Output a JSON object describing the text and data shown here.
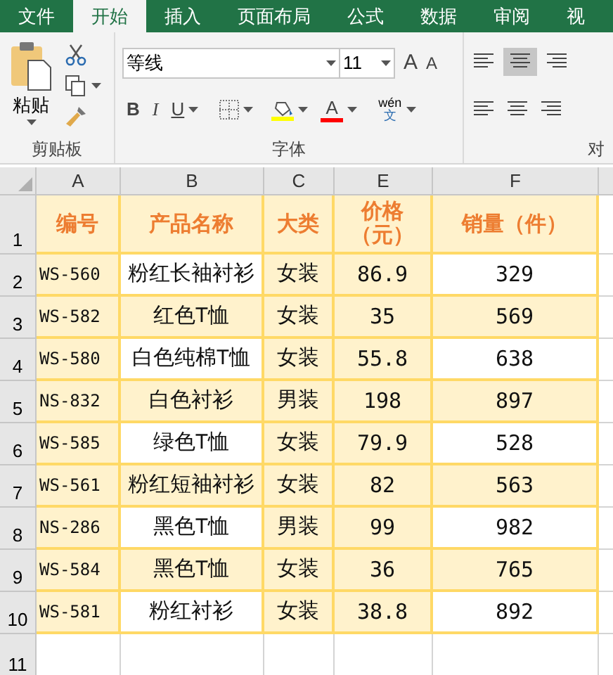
{
  "tabs": [
    {
      "label": "文件",
      "selected": false
    },
    {
      "label": "开始",
      "selected": true
    },
    {
      "label": "插入",
      "selected": false
    },
    {
      "label": "页面布局",
      "selected": false
    },
    {
      "label": "公式",
      "selected": false
    },
    {
      "label": "数据",
      "selected": false
    },
    {
      "label": "审阅",
      "selected": false
    },
    {
      "label": "视",
      "selected": false
    }
  ],
  "clipboard": {
    "paste_label": "粘贴",
    "group_label": "剪贴板"
  },
  "font": {
    "font_name": "等线",
    "font_size": "11",
    "grow": "A",
    "shrink": "A",
    "bold": "B",
    "italic": "I",
    "underline": "U",
    "font_color": "A",
    "phonetic_top": "wén",
    "phonetic_bottom": "文",
    "group_label": "字体"
  },
  "alignment": {
    "group_label": "对"
  },
  "columns": [
    "A",
    "B",
    "C",
    "E",
    "F"
  ],
  "header": {
    "row": "1",
    "cells": [
      "编号",
      "产品名称",
      "大类",
      "价格（元）",
      "销量（件）"
    ]
  },
  "rows": [
    {
      "row": "2",
      "highlighted": false,
      "cells": [
        "WS-560",
        "粉红长袖衬衫",
        "女装",
        "86.9",
        "329"
      ]
    },
    {
      "row": "3",
      "highlighted": true,
      "cells": [
        "WS-582",
        "红色T恤",
        "女装",
        "35",
        "569"
      ]
    },
    {
      "row": "4",
      "highlighted": false,
      "cells": [
        "WS-580",
        "白色纯棉T恤",
        "女装",
        "55.8",
        "638"
      ]
    },
    {
      "row": "5",
      "highlighted": true,
      "cells": [
        "NS-832",
        "白色衬衫",
        "男装",
        "198",
        "897"
      ]
    },
    {
      "row": "6",
      "highlighted": false,
      "cells": [
        "WS-585",
        "绿色T恤",
        "女装",
        "79.9",
        "528"
      ]
    },
    {
      "row": "7",
      "highlighted": true,
      "cells": [
        "WS-561",
        "粉红短袖衬衫",
        "女装",
        "82",
        "563"
      ]
    },
    {
      "row": "8",
      "highlighted": false,
      "cells": [
        "NS-286",
        "黑色T恤",
        "男装",
        "99",
        "982"
      ]
    },
    {
      "row": "9",
      "highlighted": true,
      "cells": [
        "WS-584",
        "黑色T恤",
        "女装",
        "36",
        "765"
      ]
    },
    {
      "row": "10",
      "highlighted": false,
      "cells": [
        "WS-581",
        "粉红衬衫",
        "女装",
        "38.8",
        "892"
      ]
    }
  ],
  "empty_row": "11"
}
